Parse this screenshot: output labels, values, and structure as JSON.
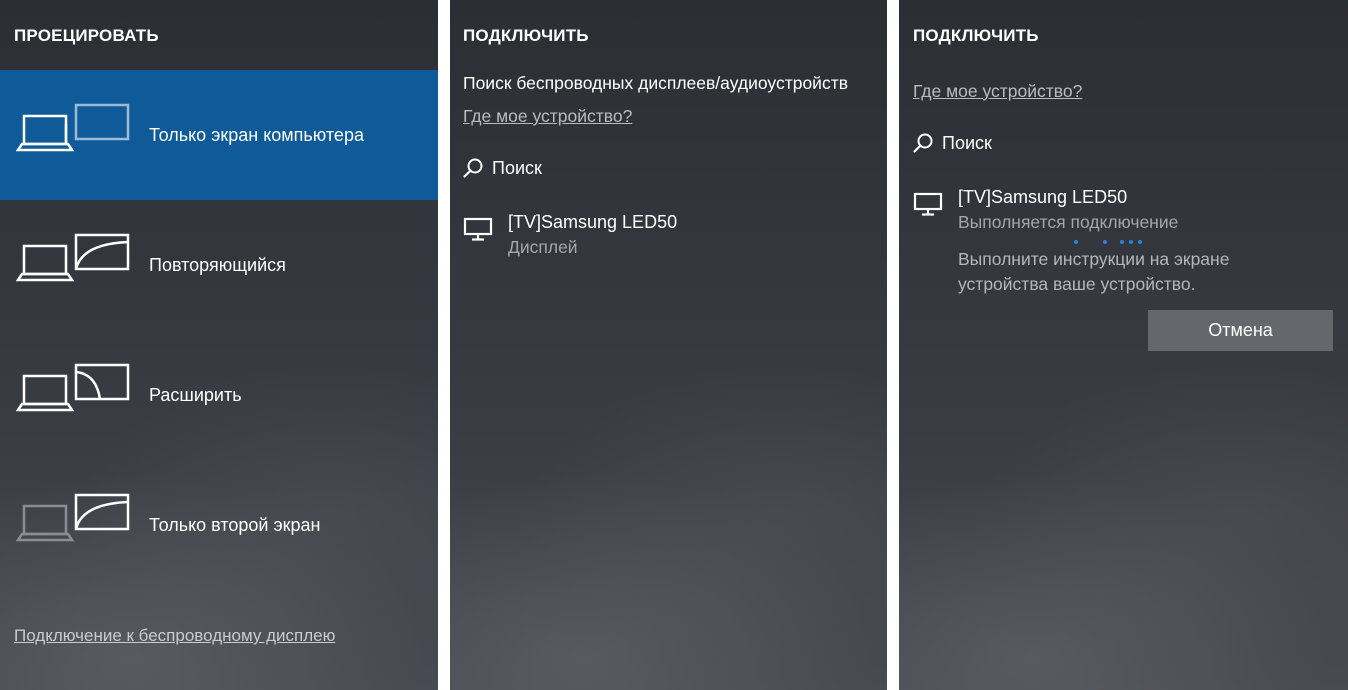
{
  "project_panel": {
    "title": "ПРОЕЦИРОВАТЬ",
    "options": [
      {
        "label": "Только экран компьютера",
        "selected": true
      },
      {
        "label": "Повторяющийся",
        "selected": false
      },
      {
        "label": "Расширить",
        "selected": false
      },
      {
        "label": "Только второй экран",
        "selected": false
      }
    ],
    "wireless_link": "Подключение к беспроводному дисплею"
  },
  "connect_panel": {
    "title": "ПОДКЛЮЧИТЬ",
    "subtitle": "Поиск беспроводных дисплеев/аудиоустройств",
    "help_link": "Где мое устройство?",
    "search_label": "Поиск",
    "device": {
      "name": "[TV]Samsung LED50",
      "type": "Дисплей"
    }
  },
  "connecting_panel": {
    "title": "ПОДКЛЮЧИТЬ",
    "help_link": "Где мое устройство?",
    "search_label": "Поиск",
    "device": {
      "name": "[TV]Samsung LED50",
      "status": "Выполняется подключение"
    },
    "instructions": "Выполните инструкции на экране устройства ваше устройство.",
    "cancel_label": "Отмена"
  },
  "colors": {
    "accent": "#0f5a99",
    "progress_dots": "#2e7fd8",
    "button": "#64676c"
  }
}
